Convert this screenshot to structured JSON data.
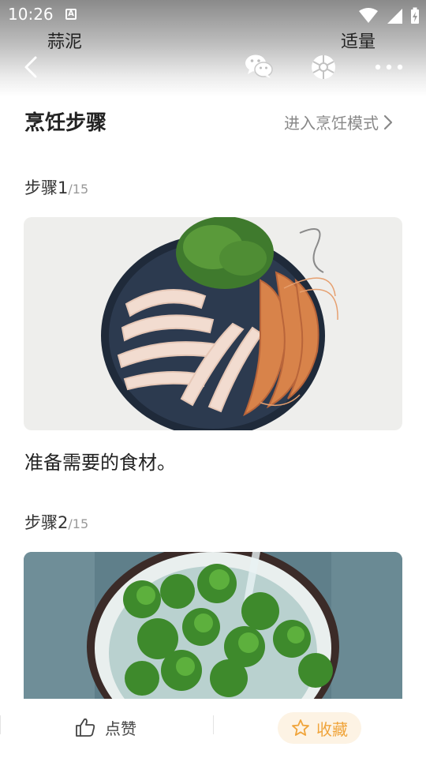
{
  "status_bar": {
    "time": "10:26",
    "notification_icon_letter": "A",
    "icons": [
      "wifi-icon",
      "signal-icon",
      "battery-charging-icon"
    ]
  },
  "ingredient_row": {
    "name": "蒜泥",
    "amount": "适量"
  },
  "nav": {
    "icons": [
      "back-icon",
      "wechat-share-icon",
      "moments-share-icon",
      "more-icon"
    ]
  },
  "section": {
    "title": "烹饪步骤",
    "cook_mode_label": "进入烹饪模式"
  },
  "steps": [
    {
      "label": "步骤1",
      "total": "/15",
      "description": "准备需要的食材。"
    },
    {
      "label": "步骤2",
      "total": "/15",
      "description": ""
    }
  ],
  "bottom_bar": {
    "like_label": "点赞",
    "favorite_label": "收藏"
  },
  "colors": {
    "accent": "#f0a43a",
    "favorite_bg": "#fdf3e4",
    "secondary_text": "#888888"
  }
}
